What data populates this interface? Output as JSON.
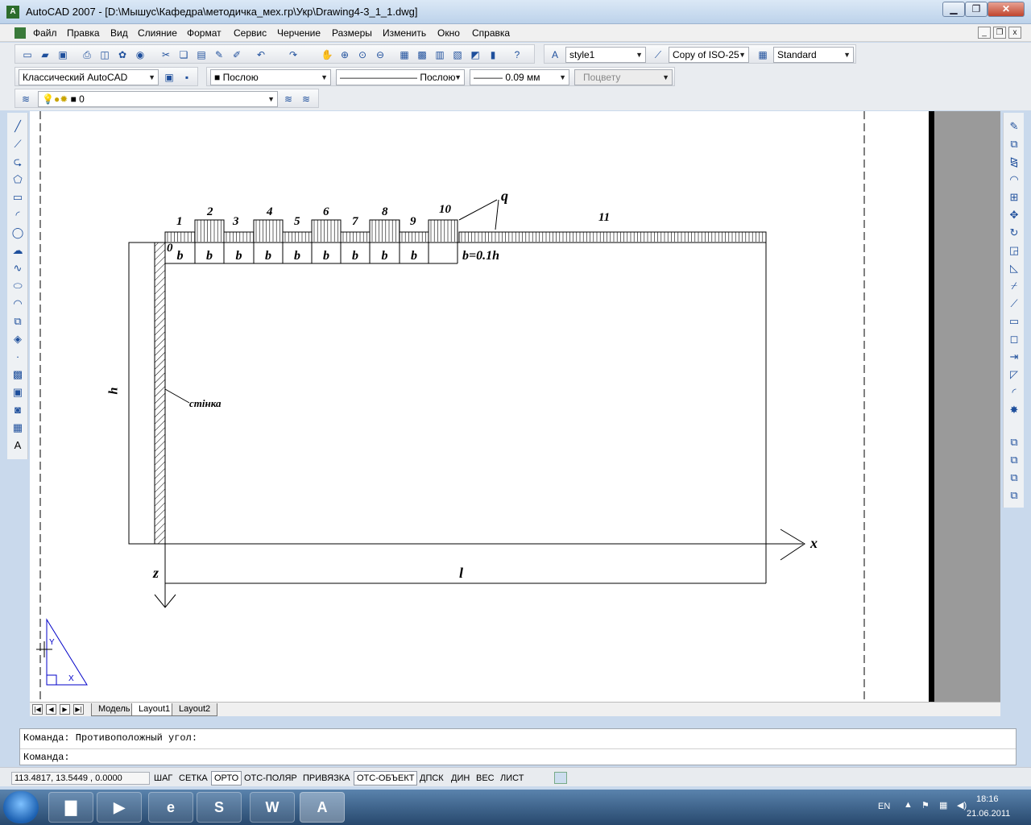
{
  "window": {
    "app_icon": "autocad-icon",
    "title": "AutoCAD 2007 - [D:\\Мышус\\Кафедра\\методичка_мех.гр\\Укр\\Drawing4-3_1_1.dwg]",
    "minimize": "▁",
    "maximize": "❐",
    "close": "✕"
  },
  "menu": {
    "items": [
      "Файл",
      "Правка",
      "Вид",
      "Слияние",
      "Формат",
      "Сервис",
      "Черчение",
      "Размеры",
      "Изменить",
      "Окно",
      "Справка"
    ],
    "mdi_min": "_",
    "mdi_restore": "❐",
    "mdi_close": "x"
  },
  "toolbar_standard": {
    "text_style": "style1",
    "dim_style": "Copy of ISO-25",
    "table_style": "Standard"
  },
  "toolbar_properties": {
    "workspace": "Классический AutoCAD",
    "color": "Послою",
    "linetype": "Послою",
    "lineweight": "0.09 мм",
    "plotstyle": "Поцвету"
  },
  "toolbar_layers": {
    "current_layer": "0"
  },
  "drawing": {
    "load_labels": [
      "1",
      "2",
      "3",
      "4",
      "5",
      "6",
      "7",
      "8",
      "9",
      "10",
      "11"
    ],
    "segment_labels": [
      "b",
      "b",
      "b",
      "b",
      "b",
      "b",
      "b",
      "b",
      "b"
    ],
    "origin": "0",
    "b_def": "b=0.1h",
    "load_q": "q",
    "height": "h",
    "wall": "стінка",
    "axis_x": "x",
    "axis_z": "z",
    "length": "l",
    "ucs_y": "Y",
    "ucs_x": "X"
  },
  "tabs": {
    "items": [
      "Модель",
      "Layout1",
      "Layout2"
    ],
    "active": "Layout1"
  },
  "command": {
    "line1": "Команда: Противоположный угол:",
    "line2": "Команда:"
  },
  "status": {
    "coords": "113.4817, 13.5449 , 0.0000",
    "buttons": [
      {
        "label": "ШАГ",
        "on": false
      },
      {
        "label": "СЕТКА",
        "on": false
      },
      {
        "label": "ОРТО",
        "on": true
      },
      {
        "label": "ОТС-ПОЛЯР",
        "on": false
      },
      {
        "label": "ПРИВЯЗКА",
        "on": false
      },
      {
        "label": "ОТС-ОБЪЕКТ",
        "on": true
      },
      {
        "label": "ДПСК",
        "on": false
      },
      {
        "label": "ДИН",
        "on": false
      },
      {
        "label": "ВЕС",
        "on": false
      },
      {
        "label": "ЛИСТ",
        "on": false
      }
    ]
  },
  "taskbar": {
    "apps": [
      "explorer",
      "media-player",
      "internet-explorer",
      "skype",
      "word",
      "autocad"
    ],
    "word_label": "W",
    "skype_label": "S",
    "ie_label": "e",
    "autocad_label": "A",
    "lang": "EN",
    "time": "18:16",
    "date": "21.06.2011"
  }
}
